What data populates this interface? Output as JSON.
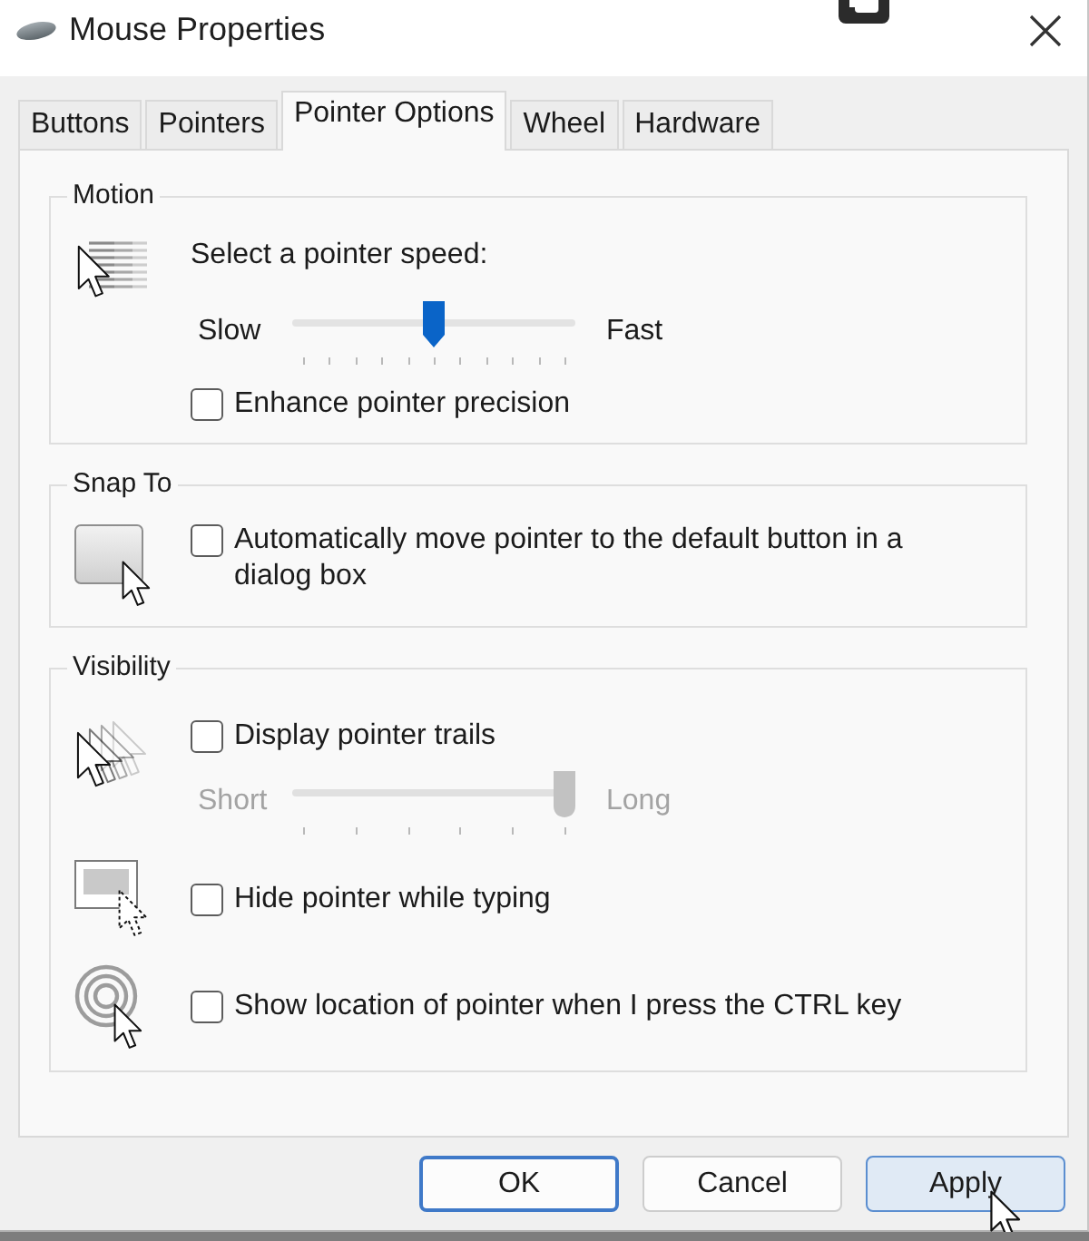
{
  "window": {
    "title": "Mouse Properties"
  },
  "tabs": [
    {
      "label": "Buttons",
      "selected": false
    },
    {
      "label": "Pointers",
      "selected": false
    },
    {
      "label": "Pointer Options",
      "selected": true
    },
    {
      "label": "Wheel",
      "selected": false
    },
    {
      "label": "Hardware",
      "selected": false
    }
  ],
  "groups": [
    {
      "legend": "Motion",
      "blocks": [
        {
          "kind": "speed",
          "items": [
            {
              "kind": "caption",
              "text": "Select a pointer speed:"
            },
            {
              "kind": "slider",
              "min_label": "Slow",
              "max_label": "Fast",
              "level": 0.5,
              "disabled": false
            },
            {
              "kind": "checkbox",
              "label": "Enhance pointer precision",
              "checked": false
            }
          ]
        }
      ]
    },
    {
      "legend": "Snap To",
      "blocks": [
        {
          "kind": "snap",
          "items": [
            {
              "kind": "checkbox",
              "label": "Automatically move pointer to the default button in a dialog box",
              "checked": false
            }
          ]
        }
      ]
    },
    {
      "legend": "Visibility",
      "blocks": [
        {
          "kind": "trails",
          "items": [
            {
              "kind": "checkbox",
              "label": "Display pointer trails",
              "checked": false
            },
            {
              "kind": "slider",
              "min_label": "Short",
              "max_label": "Long",
              "level": 1,
              "disabled": true
            }
          ]
        },
        {
          "kind": "hide",
          "items": [
            {
              "kind": "checkbox",
              "label": "Hide pointer while typing",
              "checked": false
            }
          ]
        },
        {
          "kind": "location",
          "items": [
            {
              "kind": "checkbox",
              "label": "Show location of pointer when I press the CTRL key",
              "checked": false
            }
          ]
        }
      ]
    }
  ],
  "buttons": [
    {
      "label": "OK",
      "default": true,
      "hovered": false
    },
    {
      "label": "Cancel",
      "default": false,
      "hovered": false
    },
    {
      "label": "Apply",
      "default": false,
      "hovered": true
    }
  ]
}
